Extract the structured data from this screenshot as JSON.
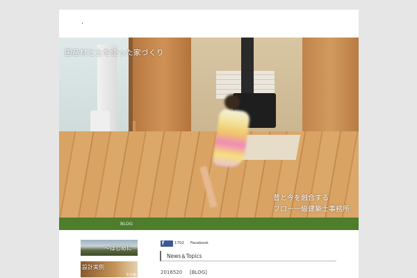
{
  "header": {
    "site_mark": "."
  },
  "hero": {
    "caption_top": "国産材と土を使った家づくり",
    "caption_bottom_line1": "昔と今を融合する",
    "caption_bottom_line2": "フロー一級建築士事務所"
  },
  "nav": {
    "items": [
      {
        "label": "BLOG"
      }
    ]
  },
  "sidebar": {
    "banners": [
      {
        "label": "～はじめに"
      },
      {
        "label": "設計実例",
        "sub": "その家"
      }
    ]
  },
  "social": {
    "icon": "facebook-icon",
    "count": "1702",
    "page_label": "Facebook",
    "brand_color": "#3b5998"
  },
  "news": {
    "heading": "News＆Topics",
    "items": [
      {
        "date": "2016520",
        "category": "[BLOG]"
      }
    ]
  },
  "colors": {
    "nav_bg": "#4e7d2c",
    "page_bg": "#e6e6e6"
  }
}
